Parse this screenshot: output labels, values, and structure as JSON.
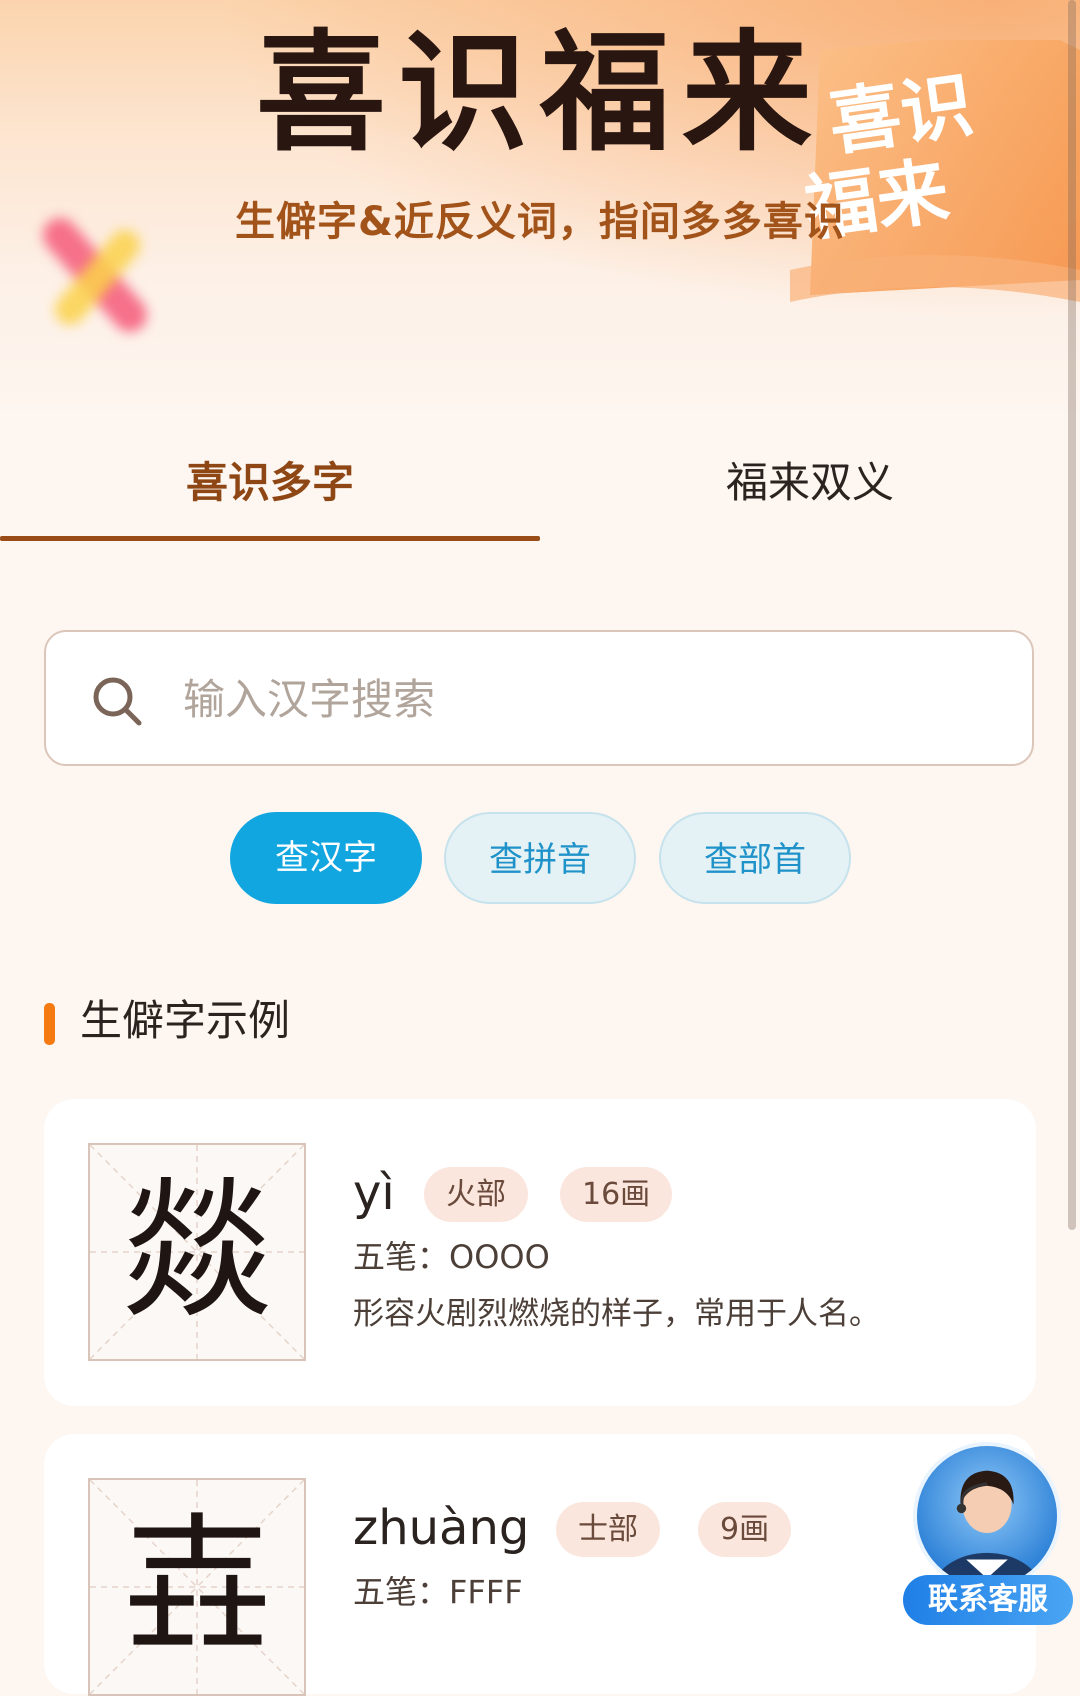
{
  "header": {
    "title": "喜识福来",
    "subtitle": "生僻字&近反义词，指间多多喜识",
    "logo_text_line1": "喜识",
    "logo_text_line2": "福来"
  },
  "tabs": [
    {
      "label": "喜识多字",
      "active": true
    },
    {
      "label": "福来双义",
      "active": false
    }
  ],
  "search": {
    "placeholder": "输入汉字搜索",
    "value": ""
  },
  "query_types": [
    {
      "label": "查汉字",
      "active": true
    },
    {
      "label": "查拼音",
      "active": false
    },
    {
      "label": "查部首",
      "active": false
    }
  ],
  "section": {
    "title": "生僻字示例"
  },
  "examples": [
    {
      "character": "燚",
      "pinyin": "yì",
      "radical": "火部",
      "strokes": "16画",
      "wubi": "五笔：OOOO",
      "meaning": "形容火剧烈燃烧的样子，常用于人名。"
    },
    {
      "character": "壵",
      "pinyin": "zhuàng",
      "radical": "士部",
      "strokes": "9画",
      "wubi": "五笔：FFFF",
      "meaning": ""
    }
  ],
  "support": {
    "label": "联系客服"
  },
  "colors": {
    "accent_brown": "#9a4c16",
    "active_blue": "#11a6e0",
    "section_orange": "#f57a12"
  }
}
